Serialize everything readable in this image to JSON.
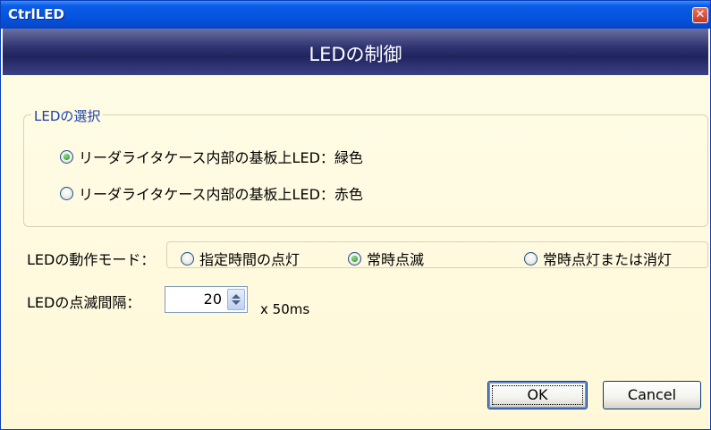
{
  "window": {
    "title": "CtrlLED",
    "close_glyph": "✕"
  },
  "header": {
    "title": "LEDの制御"
  },
  "led_select": {
    "legend": "LEDの選択",
    "options": [
      {
        "label": "リーダライタケース内部の基板上LED：緑色",
        "checked": true
      },
      {
        "label": "リーダライタケース内部の基板上LED：赤色",
        "checked": false
      }
    ]
  },
  "mode": {
    "label": "LEDの動作モード：",
    "options": [
      {
        "label": "指定時間の点灯",
        "checked": false
      },
      {
        "label": "常時点滅",
        "checked": true
      },
      {
        "label": "常時点灯または消灯",
        "checked": false
      }
    ]
  },
  "blink": {
    "label": "LEDの点滅間隔：",
    "value": "20",
    "unit": "x 50ms"
  },
  "buttons": {
    "ok": "OK",
    "cancel": "Cancel"
  },
  "colors": {
    "titlebar": "#0553e0",
    "header_band": "#2f3370",
    "background": "#fffbe0",
    "legend_text": "#1a3fb0",
    "radio_checked": "#1d8a1d"
  },
  "icons": {
    "close": "close-icon",
    "spin_up": "arrow-up-icon",
    "spin_down": "arrow-down-icon"
  }
}
